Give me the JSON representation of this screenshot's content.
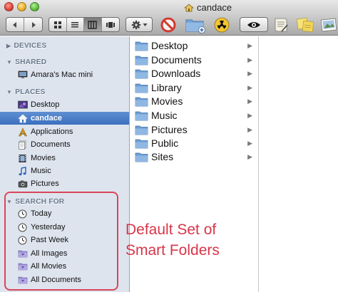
{
  "window": {
    "title": "candace",
    "colors": {
      "titlebar": "#cfcfcf",
      "sidebar": "#dde4ee",
      "selection": "#3b6fbe",
      "annotation": "#d9455a"
    }
  },
  "toolbar": {
    "nav": [
      "back-arrow-icon",
      "forward-arrow-icon"
    ],
    "view_modes": [
      "icon-view-icon",
      "list-view-icon",
      "column-view-icon",
      "coverflow-view-icon"
    ],
    "active_view": "column",
    "action_menu": "gear-icon",
    "extras": [
      "no-entry-icon",
      "new-folder-icon",
      "radiation-icon",
      "eye-icon",
      "script-icon",
      "sticky-notes-icon"
    ]
  },
  "sidebar": {
    "devices": {
      "label": "DEVICES",
      "items": []
    },
    "shared": {
      "label": "SHARED",
      "items": [
        {
          "label": "Amara's Mac mini",
          "icon": "display-icon"
        }
      ]
    },
    "places": {
      "label": "PLACES",
      "items": [
        {
          "label": "Desktop",
          "icon": "desktop-icon"
        },
        {
          "label": "candace",
          "icon": "home-icon",
          "selected": true
        },
        {
          "label": "Applications",
          "icon": "applications-icon"
        },
        {
          "label": "Documents",
          "icon": "documents-icon"
        },
        {
          "label": "Movies",
          "icon": "movies-icon"
        },
        {
          "label": "Music",
          "icon": "music-icon"
        },
        {
          "label": "Pictures",
          "icon": "pictures-icon"
        }
      ]
    },
    "search_for": {
      "label": "SEARCH FOR",
      "items": [
        {
          "label": "Today",
          "icon": "clock-icon"
        },
        {
          "label": "Yesterday",
          "icon": "clock-icon"
        },
        {
          "label": "Past Week",
          "icon": "clock-icon"
        },
        {
          "label": "All Images",
          "icon": "smart-folder-icon"
        },
        {
          "label": "All Movies",
          "icon": "smart-folder-icon"
        },
        {
          "label": "All Documents",
          "icon": "smart-folder-icon"
        }
      ]
    }
  },
  "column": {
    "items": [
      {
        "label": "Desktop"
      },
      {
        "label": "Documents"
      },
      {
        "label": "Downloads"
      },
      {
        "label": "Library"
      },
      {
        "label": "Movies"
      },
      {
        "label": "Music"
      },
      {
        "label": "Pictures"
      },
      {
        "label": "Public"
      },
      {
        "label": "Sites"
      }
    ]
  },
  "annotation": {
    "line1": "Default Set of",
    "line2": "Smart Folders"
  }
}
